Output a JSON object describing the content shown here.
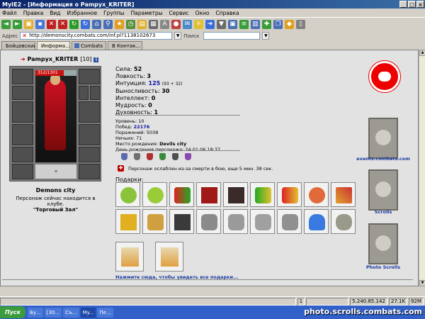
{
  "window": {
    "title": "MyIE2 - [Информация о Pampyx_KRITER]"
  },
  "menu": [
    "Файл",
    "Правка",
    "Вид",
    "Избранное",
    "Группы",
    "Параметры",
    "Сервис",
    "Окно",
    "Справка"
  ],
  "address": {
    "label": "Адрес",
    "url": "http://demonscity.combats.com/inf.pl?1138102673",
    "search_label": "Поиск"
  },
  "tabs": [
    "Бойцовский...",
    "Информа...",
    "Combats",
    "В Контак..."
  ],
  "character": {
    "name": "Pampyx_KRITER",
    "level": "[10]",
    "hp": "312/1301",
    "city": "Demons city",
    "location_text": "Персонаж сейчас находится в клубе.",
    "room": "\"Торговый Зал\""
  },
  "stats": {
    "strength_label": "Сила:",
    "strength": "52",
    "agility_label": "Ловкость:",
    "agility": "3",
    "intuition_label": "Интуиция:",
    "intuition": "125",
    "intuition_extra": "(93 + 32)",
    "endurance_label": "Выносливость:",
    "endurance": "30",
    "intellect_label": "Интеллект:",
    "intellect": "0",
    "wisdom_label": "Мудрость:",
    "wisdom": "0",
    "spirit_label": "Духовность:",
    "spirit": "1"
  },
  "info": {
    "level_line": "Уровень: 10",
    "wins_label": "Побед:",
    "wins": "22176",
    "losses_line": "Поражений: 5038",
    "draws_line": "Ничьих: 71",
    "birthplace_label": "Место рождения:",
    "birthplace": "Devils city",
    "birthday_line": "День рождения персонажа: 24.01.06 18:37"
  },
  "weakened_text": "Персонаж ослаблен из-за смерти в бою, еще 5 мин. 38 сек.",
  "gifts": {
    "label": "Подарки:",
    "more_link": "Нажмите сюда, чтобы увидеть все подарки..."
  },
  "sidebar_links": {
    "events": "events.combats.com",
    "scrolls": "Scrolls",
    "photo_scrolls": "Photo Scrolls"
  },
  "statusbar": {
    "count": "1",
    "ip": "5.240.85.142",
    "speed": "27.1K",
    "mem": "92M"
  },
  "taskbar": {
    "start": "Пуск",
    "tasks": [
      "Бу...",
      "[30...",
      "Съ...",
      "My...",
      "Пе..."
    ],
    "watermark": "photo.scrolls.combats.com"
  },
  "colors": {
    "titlebar": "#0a246a",
    "accent_red": "#e00000",
    "link_blue": "#1a3aa0"
  }
}
